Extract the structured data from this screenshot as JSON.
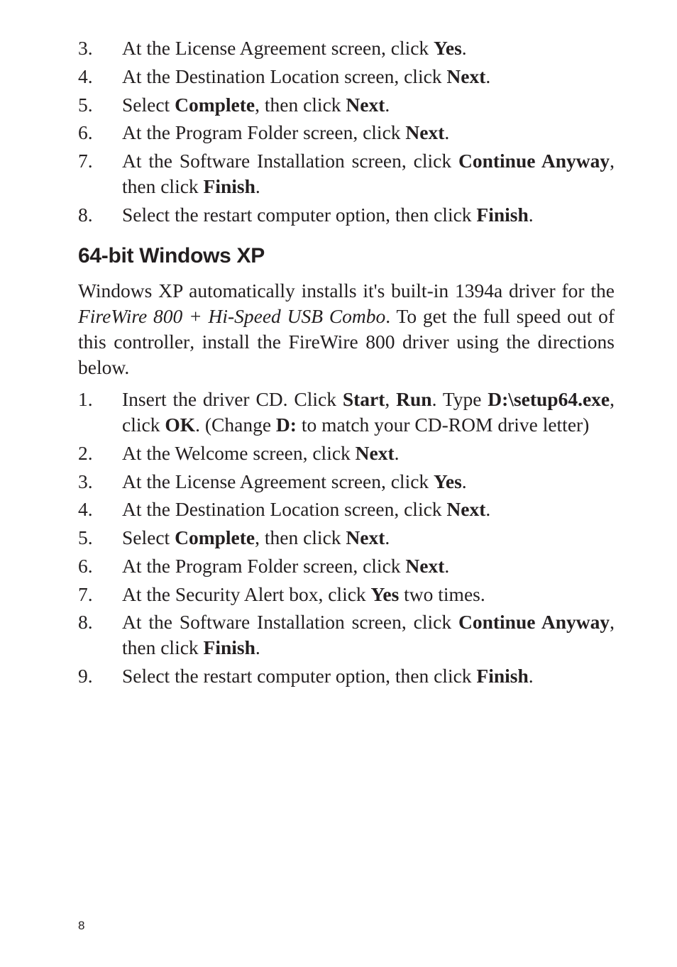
{
  "list1": {
    "i3": {
      "n": "3.",
      "a": "At the License Agreement screen, click ",
      "b": "Yes",
      "c": "."
    },
    "i4": {
      "n": "4.",
      "a": "At the Destination Location screen, click ",
      "b": "Next",
      "c": "."
    },
    "i5": {
      "n": "5.",
      "a": "Select ",
      "b1": "Complete",
      "c": ", then click ",
      "b2": "Next",
      "d": "."
    },
    "i6": {
      "n": "6.",
      "a": "At the Program Folder screen, click ",
      "b": "Next",
      "c": "."
    },
    "i7": {
      "n": "7.",
      "a": "At the Software Installation screen, click ",
      "b1": "Continue Anyway",
      "c": ", then click ",
      "b2": "Finish",
      "d": "."
    },
    "i8": {
      "n": "8.",
      "a": "Select the restart computer option, then click ",
      "b": "Finish",
      "c": "."
    }
  },
  "heading": "64-bit Windows XP",
  "intro": {
    "a": "Windows XP automatically installs it's built-in 1394a driver for the ",
    "ital": "FireWire 800 + Hi-Speed USB Combo",
    "b": ".  To get the full speed out of this controller",
    "ital2": ",",
    "c": " install the FireWire 800 driver using the directions below."
  },
  "list2": {
    "i1": {
      "n": "1.",
      "a": "Insert the driver CD.  Click ",
      "b1": "Start",
      "c1": ", ",
      "b2": "Run",
      "c2": ".  Type ",
      "b3": "D:\\setup64.exe",
      "c3": ", click ",
      "b4": "OK",
      "c4": ". (Change ",
      "b5": "D:",
      "c5": " to match your CD-ROM drive letter)"
    },
    "i2": {
      "n": "2.",
      "a": "At the Welcome screen, click ",
      "b": "Next",
      "c": "."
    },
    "i3": {
      "n": "3.",
      "a": "At the License Agreement screen, click ",
      "b": "Yes",
      "c": "."
    },
    "i4": {
      "n": "4.",
      "a": "At the Destination Location screen, click ",
      "b": "Next",
      "c": "."
    },
    "i5": {
      "n": "5.",
      "a": "Select ",
      "b1": "Complete",
      "c": ", then click ",
      "b2": "Next",
      "d": "."
    },
    "i6": {
      "n": "6.",
      "a": "At the Program Folder screen, click ",
      "b": "Next",
      "c": "."
    },
    "i7": {
      "n": "7.",
      "a": "At the Security Alert box, click ",
      "b": "Yes",
      "c": " two times."
    },
    "i8": {
      "n": "8.",
      "a": "At the Software Installation screen, click ",
      "b1": "Continue Anyway",
      "c": ", then click ",
      "b2": "Finish",
      "d": "."
    },
    "i9": {
      "n": "9.",
      "a": "Select the restart computer option, then click ",
      "b": "Finish",
      "c": "."
    }
  },
  "pageNumber": "8"
}
